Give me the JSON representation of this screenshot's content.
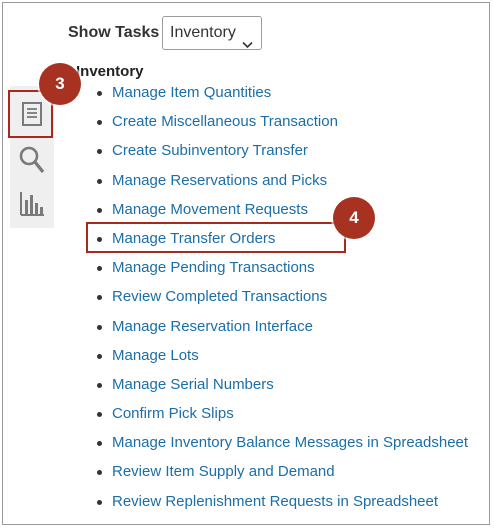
{
  "header": {
    "show_tasks_label": "Show Tasks",
    "task_filter_value": "Inventory"
  },
  "sidebar": {
    "items": [
      {
        "icon": "task-list-icon",
        "selected": true
      },
      {
        "icon": "search-icon",
        "selected": false
      },
      {
        "icon": "bar-chart-icon",
        "selected": false
      }
    ]
  },
  "task_group": {
    "title": "Inventory",
    "items": [
      "Manage Item Quantities",
      "Create Miscellaneous Transaction",
      "Create Subinventory Transfer",
      "Manage Reservations and Picks",
      "Manage Movement Requests",
      "Manage Transfer Orders",
      "Manage Pending Transactions",
      "Review Completed Transactions",
      "Manage Reservation Interface",
      "Manage Lots",
      "Manage Serial Numbers",
      "Confirm Pick Slips",
      "Manage Inventory Balance Messages in Spreadsheet",
      "Review Item Supply and Demand",
      "Review Replenishment Requests in Spreadsheet"
    ]
  },
  "callouts": {
    "step_3": "3",
    "step_4": "4",
    "color": "#a83222"
  },
  "colors": {
    "link": "#1b6ea8",
    "highlight_border": "#a52a1d"
  }
}
